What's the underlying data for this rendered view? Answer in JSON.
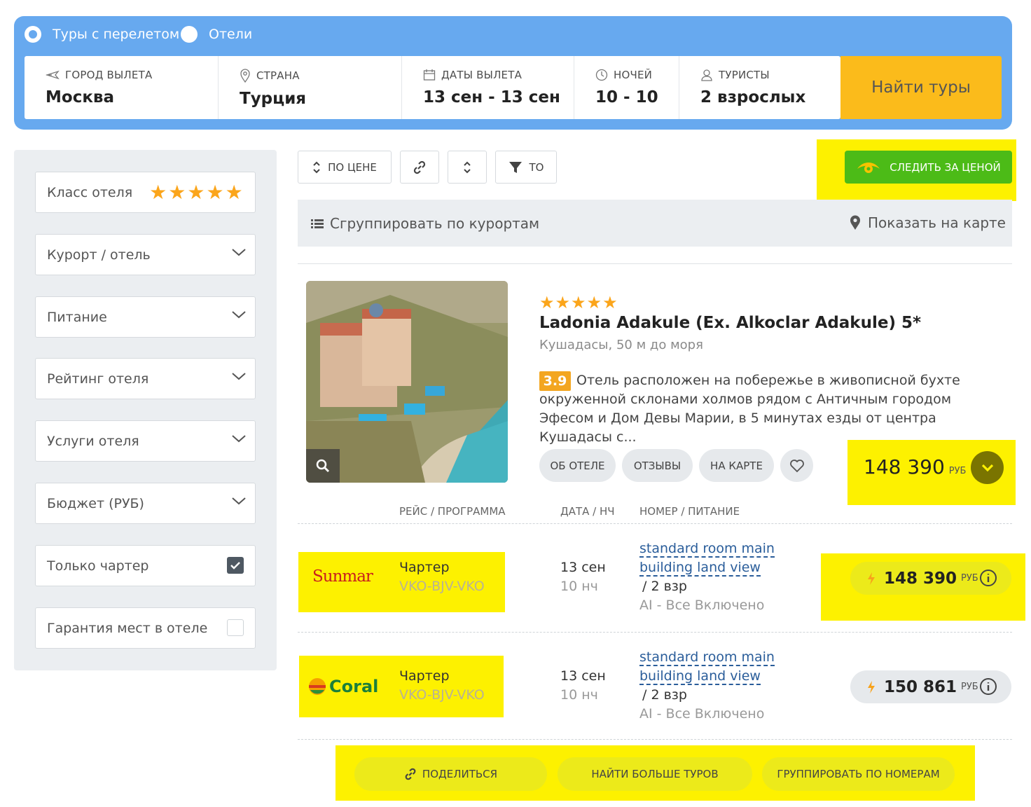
{
  "search": {
    "radio_tours": "Туры с перелетом",
    "radio_hotels": "Отели",
    "fields": [
      {
        "label": "ГОРОД ВЫЛЕТА",
        "value": "Москва",
        "icon": "plane-icon"
      },
      {
        "label": "СТРАНА",
        "value": "Турция",
        "icon": "map-pin-icon"
      },
      {
        "label": "ДАТЫ ВЫЛЕТА",
        "value": "13 сен - 13 сен",
        "icon": "calendar-icon"
      },
      {
        "label": "НОЧЕЙ",
        "value": "10 - 10",
        "icon": "clock-icon"
      },
      {
        "label": "ТУРИСТЫ",
        "value": "2 взрослых",
        "icon": "user-icon"
      }
    ],
    "find_button": "Найти туры"
  },
  "filters": {
    "hotel_class": "Класс отеля",
    "stars": "★★★★★",
    "resort": "Курорт / отель",
    "meal": "Питание",
    "rating": "Рейтинг отеля",
    "services": "Услуги отеля",
    "budget": "Бюджет (РУБ)",
    "charter_only": "Только чартер",
    "charter_checked": true,
    "guarantee": "Гарантия мест в отеле",
    "guarantee_checked": false
  },
  "toolbar": {
    "sort_price": "ПО ЦЕНЕ",
    "filter_to": "ТО",
    "watch_price": "СЛЕДИТЬ ЗА ЦЕНОЙ",
    "group_by_resort": "Сгруппировать по курортам",
    "show_on_map": "Показать на карте"
  },
  "hotel": {
    "stars": "★★★★★",
    "name": "Ladonia Adakule (Ex. Alkoclar Adakule) 5*",
    "location": "Кушадасы, 50 м до моря",
    "rating": "3.9",
    "description": "Отель расположен на побережье в живописной бухте окруженной склонами холмов рядом с Античным городом Эфесом и Дом Девы Марии, в 5 минутах езды от центра Кушадасы с...",
    "btn_about": "ОБ ОТЕЛЕ",
    "btn_reviews": "ОТЗЫВЫ",
    "btn_map": "НА КАРТЕ",
    "price": "148 390",
    "currency": "РУБ"
  },
  "table_headers": {
    "program": "РЕЙС / ПРОГРАММА",
    "date": "ДАТА / НЧ",
    "room": "НОМЕР / ПИТАНИЕ"
  },
  "offers": [
    {
      "operator": "Sunmar",
      "program": "Чартер",
      "route": "VKO-BJV-VKO",
      "date": "13 сен",
      "nights": "10 нч",
      "room_line1": "standard room main",
      "room_line2": "building land view",
      "occupancy": "/ 2 взр",
      "meal": "AI - Все Включено",
      "price": "148 390",
      "currency": "РУБ"
    },
    {
      "operator": "Coral",
      "program": "Чартер",
      "route": "VKO-BJV-VKO",
      "date": "13 сен",
      "nights": "10 нч",
      "room_line1": "standard room main",
      "room_line2": "building land view",
      "occupancy": "/ 2 взр",
      "meal": "AI - Все Включено",
      "price": "150 861",
      "currency": "РУБ"
    }
  ],
  "bottom": {
    "share": "ПОДЕЛИТЬСЯ",
    "more_tours": "НАЙТИ БОЛЬШЕ ТУРОВ",
    "group_rooms": "ГРУППИРОВАТЬ ПО НОМЕРАМ"
  },
  "colors": {
    "panel_blue": "#67a9ef",
    "find_yellow": "#fbbb1b",
    "watch_green": "#4cbb17",
    "star_orange": "#fba51b",
    "highlight": "#fdf100"
  }
}
